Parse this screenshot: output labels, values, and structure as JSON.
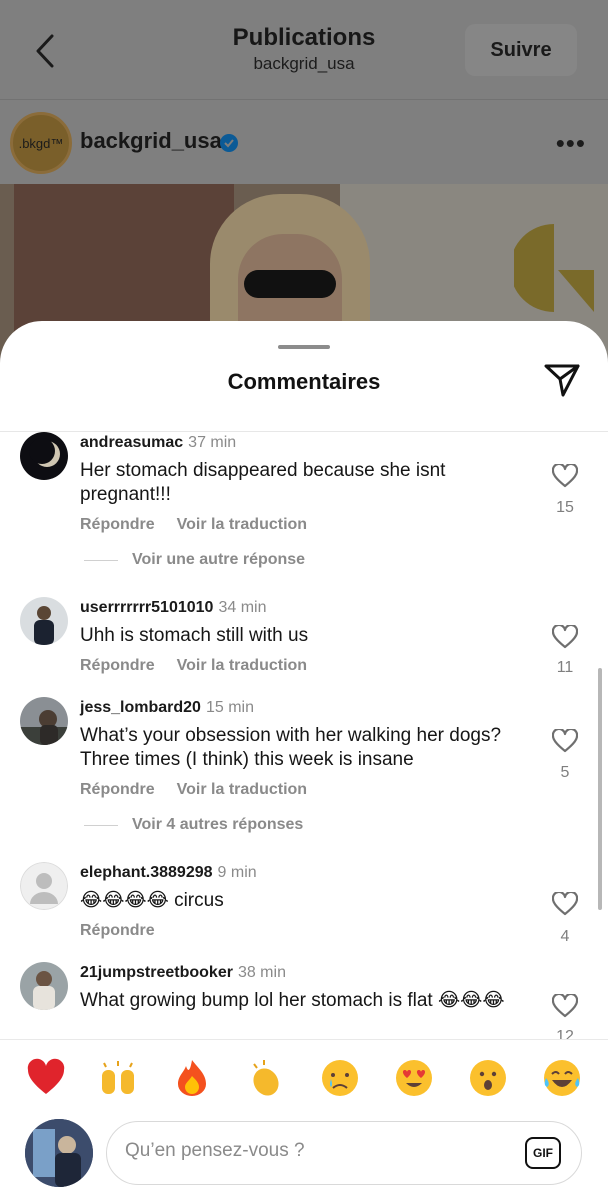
{
  "header": {
    "title": "Publications",
    "subtitle": "backgrid_usa",
    "follow_label": "Suivre"
  },
  "post": {
    "username": "backgrid_usa",
    "avatar_text": ".bkgd™",
    "verified": true
  },
  "sheet": {
    "title": "Commentaires"
  },
  "comments": [
    {
      "user": "andreasumac",
      "time": "37 min",
      "text": "Her stomach disappeared because she isnt pregnant!!!",
      "reply": "Répondre",
      "translate": "Voir la traduction",
      "likes": "15",
      "more_replies": "Voir une autre réponse"
    },
    {
      "user": "userrrrrrr5101010",
      "time": "34 min",
      "text": "Uhh is stomach still with us",
      "reply": "Répondre",
      "translate": "Voir la traduction",
      "likes": "11"
    },
    {
      "user": "jess_lombard20",
      "time": "15 min",
      "text": "What’s your obsession with her walking her dogs? Three times (I think) this week is insane",
      "reply": "Répondre",
      "translate": "Voir la traduction",
      "likes": "5",
      "more_replies": "Voir 4 autres réponses"
    },
    {
      "user": "elephant.3889298",
      "time": "9 min",
      "text": "😂😂😂😂 circus",
      "reply": "Répondre",
      "likes": "4"
    },
    {
      "user": "21jumpstreetbooker",
      "time": "38 min",
      "text": "What growing bump lol her stomach is flat 😂😂😂",
      "likes": "12"
    }
  ],
  "quick_reactions": [
    "heart",
    "raising-hands",
    "fire",
    "clapping-hands",
    "crying-face",
    "heart-eyes",
    "surprised-face",
    "tears-of-joy"
  ],
  "composer": {
    "placeholder": "Qu’en pensez-vous ?",
    "gif_label": "GIF"
  },
  "colors": {
    "dim_overlay": "#7d7d7d",
    "verified_blue": "#0095f6",
    "muted_text": "#8a8a8a"
  }
}
